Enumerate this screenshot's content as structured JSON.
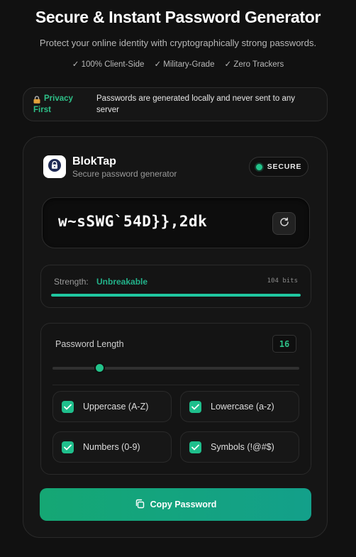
{
  "hero": {
    "title": "Secure & Instant Password Generator",
    "subtitle": "Protect your online identity with cryptographically strong passwords.",
    "features": [
      "✓ 100% Client-Side",
      "✓ Military-Grade",
      "✓ Zero Trackers"
    ]
  },
  "privacy": {
    "tag_line1": "Privacy",
    "tag_line2": "First",
    "tag_icon": "lock-icon",
    "text": "Passwords are generated locally and never sent to any server"
  },
  "brand": {
    "name": "BlokTap",
    "tagline": "Secure password generator",
    "logo_icon": "padlock-icon"
  },
  "status": {
    "label": "SECURE",
    "color": "#22c38a"
  },
  "password": {
    "value": "w~sSWG`54D}},2dk",
    "refresh_icon": "refresh-icon"
  },
  "strength": {
    "label": "Strength:",
    "value": "Unbreakable",
    "bits": "104 bits",
    "fill_fraction": 1.0,
    "color": "#1fc7a0"
  },
  "length": {
    "label": "Password Length",
    "value": "16",
    "slider_fraction": 0.19
  },
  "options": [
    {
      "label": "Uppercase (A-Z)",
      "checked": true
    },
    {
      "label": "Lowercase (a-z)",
      "checked": true
    },
    {
      "label": "Numbers (0-9)",
      "checked": true
    },
    {
      "label": "Symbols (!@#$)",
      "checked": true
    }
  ],
  "copy": {
    "label": "Copy Password",
    "icon": "copy-icon"
  },
  "colors": {
    "accent": "#22c38a",
    "background": "#111111"
  }
}
